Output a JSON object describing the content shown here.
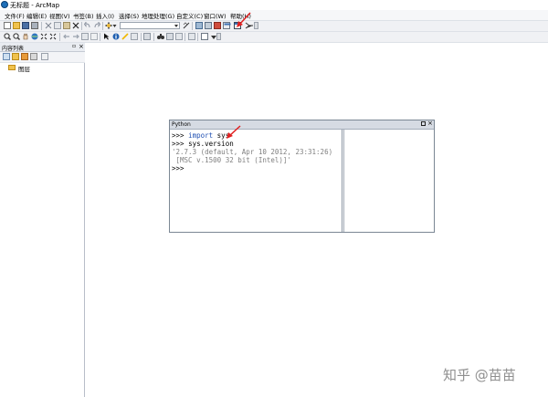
{
  "window": {
    "title": "无标题 - ArcMap"
  },
  "menubar": {
    "items": [
      {
        "label": "文件(F)"
      },
      {
        "label": "编辑(E)"
      },
      {
        "label": "视图(V)"
      },
      {
        "label": "书签(B)"
      },
      {
        "label": "插入(I)"
      },
      {
        "label": "选择(S)"
      },
      {
        "label": "地理处理(G)"
      },
      {
        "label": "自定义(C)"
      },
      {
        "label": "窗口(W)"
      },
      {
        "label": "帮助(H)"
      }
    ]
  },
  "toolbar": {
    "row1_icons": [
      "new-icon",
      "open-icon",
      "save-icon",
      "print-icon",
      "cut-icon",
      "copy-icon",
      "paste-icon",
      "delete-icon",
      "undo-icon",
      "redo-icon",
      "add-data-icon",
      "editor-icon",
      "catalog-icon",
      "search-icon",
      "arctoolbox-icon",
      "python-icon",
      "modelbuilder-icon"
    ],
    "row2_icons": [
      "zoom-in-icon",
      "zoom-out-icon",
      "pan-icon",
      "full-extent-icon",
      "fixed-zoom-in-icon",
      "fixed-zoom-out-icon",
      "back-icon",
      "forward-icon",
      "select-icon",
      "identify-icon",
      "hyperlink-icon",
      "html-popup-icon",
      "measure-icon",
      "find-icon",
      "go-to-xy-icon",
      "time-slider-icon",
      "viewer-icon"
    ]
  },
  "toc": {
    "title": "内容列表",
    "root_layer": "图层"
  },
  "python_window": {
    "title": "Python",
    "lines": [
      {
        "prompt": ">>> ",
        "keyword": "import",
        "text": " sys"
      },
      {
        "prompt": ">>> ",
        "keyword": "",
        "text": "sys.version"
      },
      {
        "prompt": "",
        "keyword": "",
        "text": "'2.7.3 (default, Apr 10 2012, 23:31:26)"
      },
      {
        "prompt": "",
        "keyword": "",
        "text": " [MSC v.1500 32 bit (Intel)]'"
      },
      {
        "prompt": ">>>",
        "keyword": "",
        "text": ""
      }
    ]
  },
  "watermark": "知乎 @苗苗",
  "colors": {
    "annotation_arrow": "#e02020",
    "keyword": "#1f4fb2",
    "output_text": "#7f7f7f"
  }
}
